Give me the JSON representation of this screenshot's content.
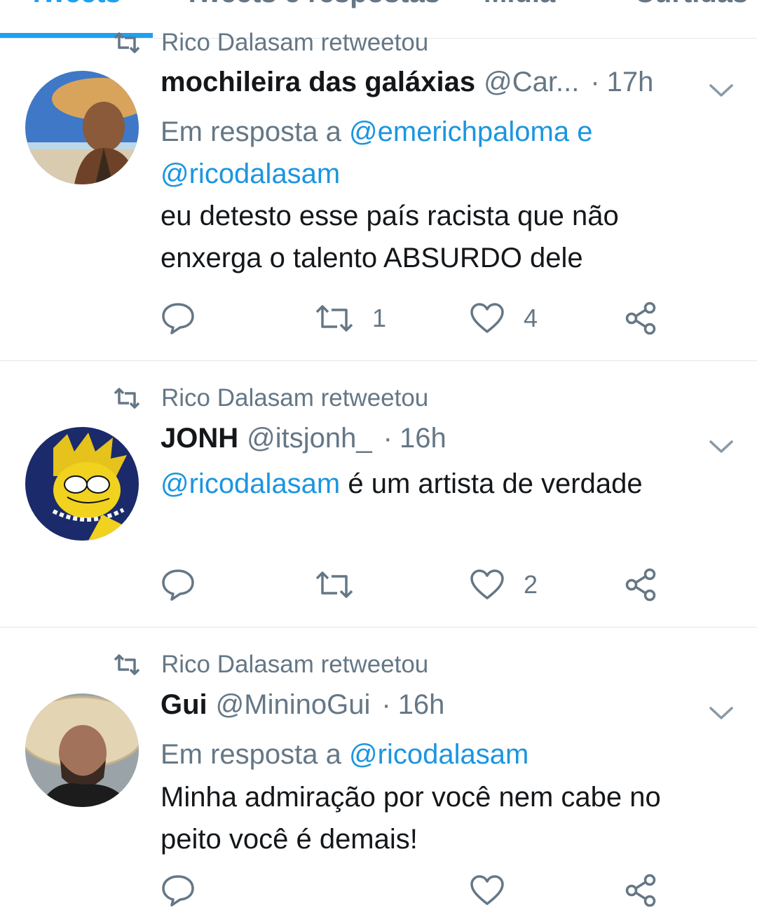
{
  "tabs": [
    {
      "label": "Tweets"
    },
    {
      "label": "Tweets e respostas"
    },
    {
      "label": "Mídia"
    },
    {
      "label": "Curtidas"
    }
  ],
  "tweets": [
    {
      "retweeted_by": "Rico Dalasam retweetou",
      "name": "mochileira das galáxias",
      "handle": "@Car...",
      "separator": "·",
      "time": "17h",
      "reply_prefix": "Em resposta a ",
      "reply_mentions": "@emerichpaloma e",
      "reply_mentions_2": "@ricodalasam",
      "text_mention": "",
      "text_line1": "eu detesto esse país racista que não",
      "text_line2": "enxerga o talento ABSURDO dele",
      "retweet_count": "1",
      "like_count": "4",
      "avatar_icon": "avatar-photo-woman-hat"
    },
    {
      "retweeted_by": "Rico Dalasam retweetou",
      "name": "JONH",
      "handle": "@itsjonh_",
      "separator": "·",
      "time": "16h",
      "text_mention": "@ricodalasam",
      "text_rest": " é um artista de verdade",
      "retweet_count": "",
      "like_count": "2",
      "avatar_icon": "avatar-cartoon-character"
    },
    {
      "retweeted_by": "Rico Dalasam retweetou",
      "name": "Gui",
      "handle": "@MininoGui",
      "separator": "·",
      "time": "16h",
      "reply_prefix": "Em resposta a ",
      "reply_mentions": "@ricodalasam",
      "text_line1": "Minha admiração por você nem cabe no",
      "text_line2": "peito você é demais!",
      "avatar_icon": "avatar-photo-man-hat"
    }
  ],
  "colors": {
    "accent": "#1da1f2",
    "mention": "#1b95e0",
    "secondary_text": "#657786",
    "divider": "#e1e8ed"
  }
}
